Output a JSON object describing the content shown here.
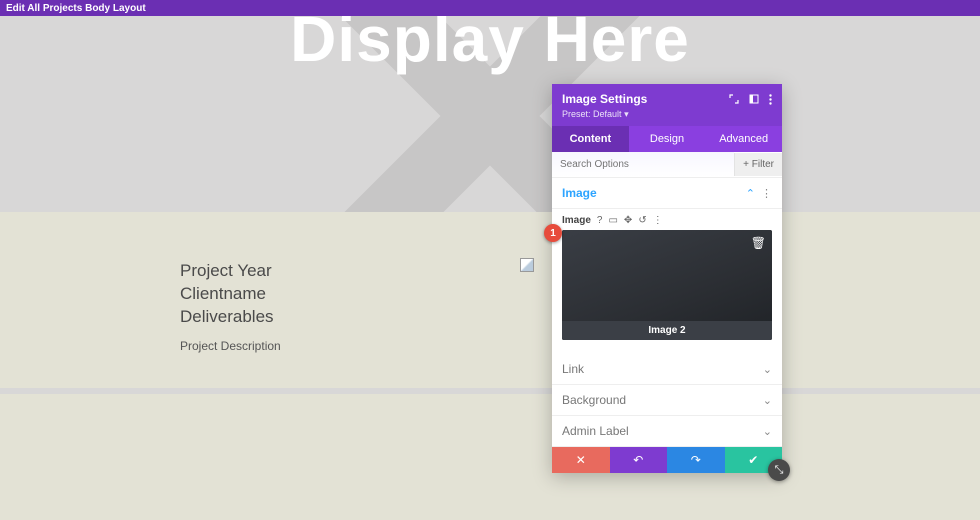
{
  "colors": {
    "brand": "#7e3bd0",
    "brand_dark": "#6b2fb3",
    "accent_blue": "#2da4ff",
    "danger": "#e74c3c",
    "success": "#29c4a0"
  },
  "top_bar": {
    "title": "Edit All Projects Body Layout"
  },
  "hero": {
    "headline": "Display Here"
  },
  "project": {
    "field_year": "Project Year",
    "field_client": "Clientname",
    "field_deliverables": "Deliverables",
    "description_label": "Project Description"
  },
  "badge": {
    "number": "1"
  },
  "panel": {
    "title": "Image Settings",
    "preset_label": "Preset:",
    "preset_value": "Default",
    "tabs": {
      "content": "Content",
      "design": "Design",
      "advanced": "Advanced",
      "active": "content"
    },
    "search": {
      "placeholder": "Search Options",
      "filter_label": "Filter"
    },
    "sections": {
      "image": {
        "title": "Image",
        "field_label": "Image",
        "preview_caption": "Image 2",
        "mini_icons": [
          "help-icon",
          "tablet-icon",
          "hover-icon",
          "reset-icon",
          "more-icon"
        ]
      },
      "link": {
        "title": "Link"
      },
      "background": {
        "title": "Background"
      },
      "admin_label": {
        "title": "Admin Label"
      }
    },
    "actions": {
      "discard": "close",
      "undo": "undo",
      "redo": "redo",
      "save": "check"
    }
  }
}
